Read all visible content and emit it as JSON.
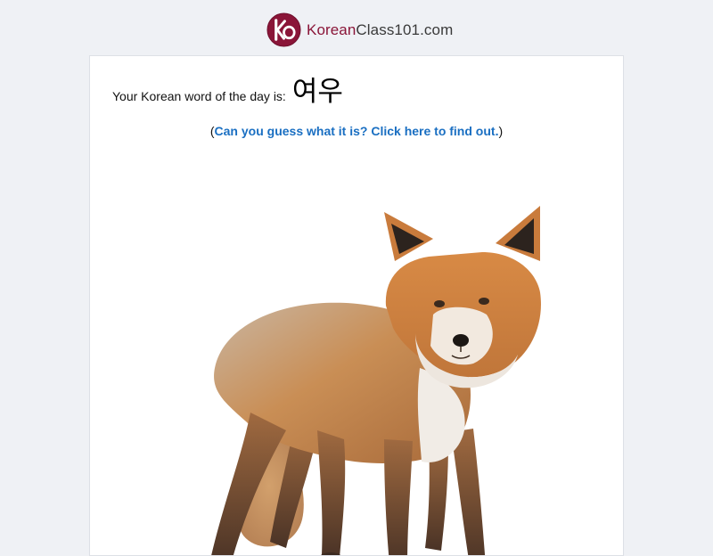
{
  "brand": {
    "name_part1": "Korean",
    "name_part2": "Class101.com",
    "badge_letters": "KO",
    "colors": {
      "badge": "#8a1538",
      "brand_text": "#8a1538",
      "link": "#1a6fc2",
      "background": "#eff1f5"
    }
  },
  "word_of_day": {
    "label": "Your Korean word of the day is:",
    "word": "여우"
  },
  "hint": {
    "open_paren": "(",
    "link_text": "Can you guess what it is? Click here to find out.",
    "close_paren": ")"
  },
  "image": {
    "subject": "fox-photo"
  }
}
